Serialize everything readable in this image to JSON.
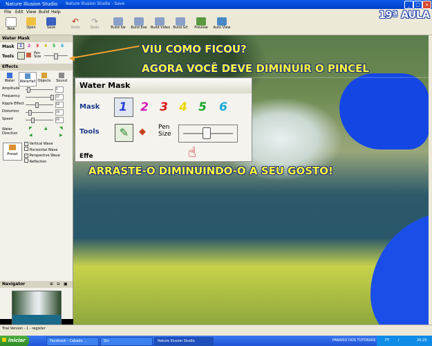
{
  "window": {
    "app_name": "Nature Illusion Studio",
    "title": "Nature Illusion Studio - Save"
  },
  "menu": [
    "File",
    "Edit",
    "View",
    "Build",
    "Help"
  ],
  "toolbar": {
    "buttons": [
      {
        "label": "New",
        "icon": "new-file-icon"
      },
      {
        "label": "Open",
        "icon": "open-folder-icon"
      },
      {
        "label": "Save",
        "icon": "save-disk-icon"
      },
      {
        "label": "Undo",
        "icon": "undo-arrow-icon"
      },
      {
        "label": "Redo",
        "icon": "redo-arrow-icon"
      },
      {
        "label": "Build Sw",
        "icon": "build-screensaver-icon"
      },
      {
        "label": "Build Exe",
        "icon": "build-exe-icon"
      },
      {
        "label": "Build Video",
        "icon": "build-video-icon"
      },
      {
        "label": "Build Gif",
        "icon": "build-gif-icon"
      },
      {
        "label": "Preview",
        "icon": "preview-icon"
      },
      {
        "label": "Auto View",
        "icon": "auto-view-icon"
      }
    ]
  },
  "left_panel": {
    "water_mask_title": "Water Mask",
    "mask_label": "Mask",
    "mask_numbers": [
      "1",
      "2",
      "3",
      "4",
      "5",
      "6"
    ],
    "tools_label": "Tools",
    "pen_size_label": "Pen Size",
    "effects_title": "Effects",
    "effect_tabs": [
      "Water",
      "Waterfall",
      "Objects",
      "Sound"
    ],
    "sliders": [
      {
        "label": "Amplitude",
        "value": "5"
      },
      {
        "label": "Frequency",
        "value": "17"
      },
      {
        "label": "Ripple Effect",
        "value": "50"
      },
      {
        "label": "Distortion",
        "value": "10"
      },
      {
        "label": "Speed",
        "value": "20"
      }
    ],
    "water_direction_label": "Water Direction",
    "preset_label": "Preset",
    "checkboxes": [
      {
        "label": "Vertical Wave",
        "checked": true
      },
      {
        "label": "Horizontal Wave",
        "checked": false
      },
      {
        "label": "Perspective Wave",
        "checked": true
      },
      {
        "label": "Reflection",
        "checked": false
      }
    ],
    "navigator_title": "Navigator"
  },
  "inset": {
    "title": "Water Mask",
    "mask_label": "Mask",
    "tools_label": "Tools",
    "pen_label_line1": "Pen",
    "pen_label_line2": "Size",
    "effects_partial": "Effe",
    "mask_colors": [
      "#2a3fd8",
      "#d81ab8",
      "#d81a1a",
      "#e8d800",
      "#18a828",
      "#18a8d8"
    ]
  },
  "annotations": {
    "line1": "VIU COMO FICOU?",
    "line2": "AGORA VOCÊ DEVE DIMINUIR O PINCEL",
    "line3": "ARRASTE-O DIMINUINDO-O A SEU GOSTO!",
    "lesson": "19ª AULA",
    "text_color": "#fdfd3a"
  },
  "status_bar": {
    "text": "Trial Version - 1 - register"
  },
  "taskbar": {
    "start_label": "Iniciar",
    "tasks": [
      "Facebook - Cabado ...",
      "Sts",
      "Nature Illusion Studio"
    ],
    "tray_text": "PARAISO DOS TUTORIAIS",
    "lang": "PT",
    "clock": "20:29"
  }
}
